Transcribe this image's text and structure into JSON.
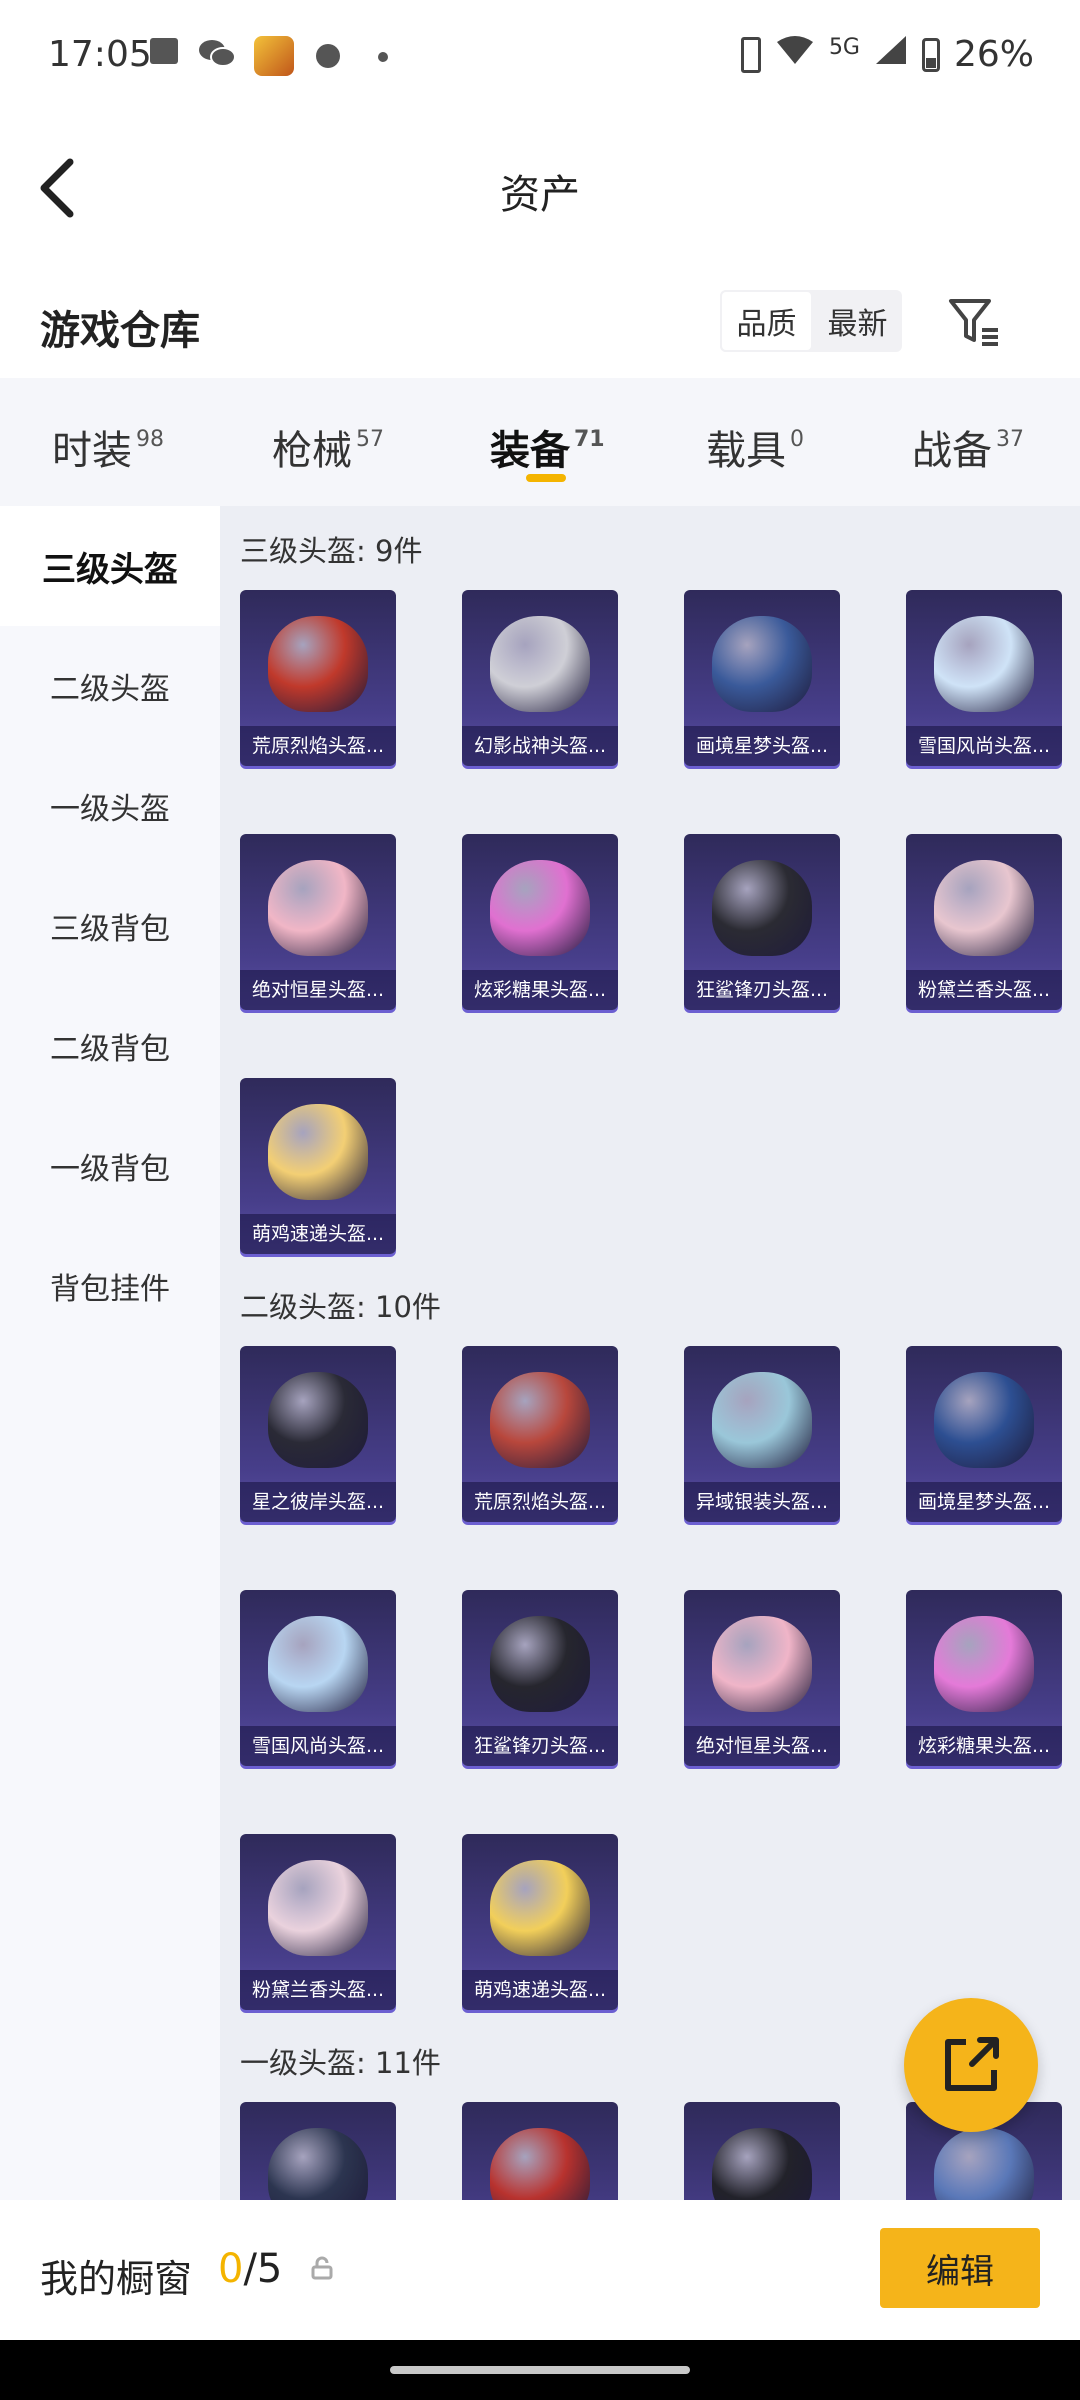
{
  "status_bar": {
    "time": "17:05",
    "network": "5G",
    "battery": "26%",
    "icons": [
      "notification-icon",
      "wechat-icon",
      "game-app-icon",
      "motorola-icon",
      "dot-icon",
      "nfc-icon",
      "wifi-icon",
      "signal-icon",
      "battery-icon"
    ]
  },
  "nav": {
    "title": "资产",
    "back_icon": "chevron-left-icon"
  },
  "section": {
    "title": "游戏仓库",
    "sort_options": [
      "品质",
      "最新"
    ],
    "sort_selected": "品质",
    "filter_icon": "filter-icon"
  },
  "tabs": [
    {
      "label": "时装",
      "count": "98"
    },
    {
      "label": "枪械",
      "count": "57"
    },
    {
      "label": "装备",
      "count": "71"
    },
    {
      "label": "载具",
      "count": "0"
    },
    {
      "label": "战备",
      "count": "37"
    }
  ],
  "active_tab": "装备",
  "accent_color": "#f4b400",
  "categories": [
    {
      "label": "三级头盔",
      "active": true
    },
    {
      "label": "二级头盔",
      "active": false
    },
    {
      "label": "一级头盔",
      "active": false
    },
    {
      "label": "三级背包",
      "active": false
    },
    {
      "label": "二级背包",
      "active": false
    },
    {
      "label": "一级背包",
      "active": false
    },
    {
      "label": "背包挂件",
      "active": false
    }
  ],
  "groups": [
    {
      "title": "三级头盔: 9件",
      "items": [
        {
          "name": "荒原烈焰头盔...",
          "color": "#c0392b"
        },
        {
          "name": "幻影战神头盔...",
          "color": "#cfcfd6"
        },
        {
          "name": "画境星梦头盔...",
          "color": "#3a5a9a"
        },
        {
          "name": "雪国风尚头盔...",
          "color": "#cfe3f7"
        },
        {
          "name": "绝对恒星头盔...",
          "color": "#f1b6c6"
        },
        {
          "name": "炫彩糖果头盔...",
          "color": "#e070d0"
        },
        {
          "name": "狂鲨锋刃头盔...",
          "color": "#2b2b33"
        },
        {
          "name": "粉黛兰香头盔...",
          "color": "#e8c6cf"
        },
        {
          "name": "萌鸡速递头盔...",
          "color": "#f3cf74"
        }
      ]
    },
    {
      "title": "二级头盔: 10件",
      "items": [
        {
          "name": "星之彼岸头盔...",
          "color": "#2a2a36"
        },
        {
          "name": "荒原烈焰头盔...",
          "color": "#b8473c"
        },
        {
          "name": "异域银装头盔...",
          "color": "#9ac7d9"
        },
        {
          "name": "画境星梦头盔...",
          "color": "#2d4f92"
        },
        {
          "name": "雪国风尚头盔...",
          "color": "#b8d6f2"
        },
        {
          "name": "狂鲨锋刃头盔...",
          "color": "#26262e"
        },
        {
          "name": "绝对恒星头盔...",
          "color": "#f0b5c8"
        },
        {
          "name": "炫彩糖果头盔...",
          "color": "#e47ad8"
        },
        {
          "name": "粉黛兰香头盔...",
          "color": "#ead2dd"
        },
        {
          "name": "萌鸡速递头盔...",
          "color": "#f2cf5a"
        }
      ]
    },
    {
      "title": "一级头盔: 11件",
      "items": [
        {
          "name": "",
          "color": "#2c3550"
        },
        {
          "name": "",
          "color": "#b8322e"
        },
        {
          "name": "",
          "color": "#22222a"
        },
        {
          "name": "",
          "color": "#5a78b8"
        }
      ]
    }
  ],
  "fab_icon": "external-link-icon",
  "bottom_bar": {
    "label": "我的橱窗",
    "current": "0",
    "total": "/5",
    "lock_icon": "lock-icon",
    "edit_label": "编辑"
  }
}
